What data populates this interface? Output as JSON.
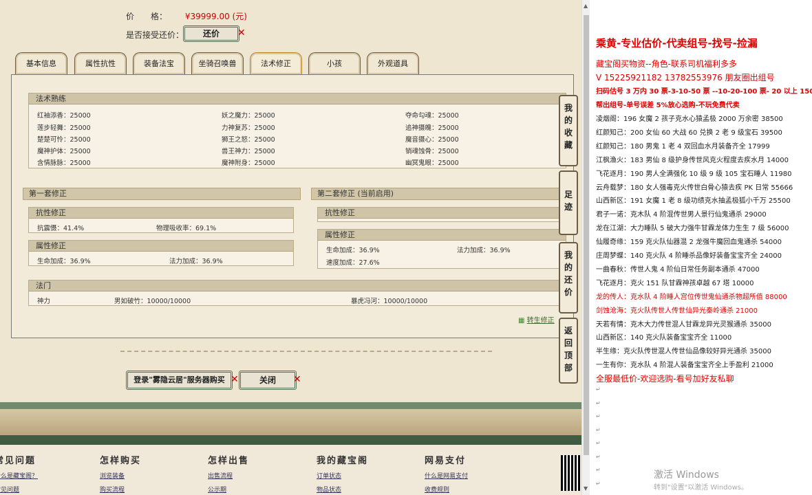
{
  "page": {
    "price_label": "价　　格：",
    "price_value": "¥39999.00 (元)",
    "bargain_label": "是否接受还价：",
    "bargain_button": "还价"
  },
  "tabs": [
    "基本信息",
    "属性抗性",
    "装备法宝",
    "坐骑召唤兽",
    "法术修正",
    "小孩",
    "外观道具"
  ],
  "spell_box": {
    "title": "法术熟练",
    "rows": [
      [
        "红袖添香：25000",
        "妖之魔力：25000",
        "夺命勾魂：25000"
      ],
      [
        "莲步轻舞：25000",
        "力神复苏：25000",
        "追神摄魄：25000"
      ],
      [
        "楚楚可怜：25000",
        "狮王之怒：25000",
        "魔音摄心：25000"
      ],
      [
        "魔神护体：25000",
        "兽王神力：25000",
        "销魂蚀骨：25000"
      ],
      [
        "含情脉脉：25000",
        "魔神附身：25000",
        "幽冥鬼眼：25000"
      ]
    ]
  },
  "set1": {
    "title": "第一套修正",
    "resist_title": "抗性修正",
    "resist": [
      "抗震慑：41.4%",
      "物理吸收率：69.1%"
    ],
    "attr_title": "属性修正",
    "attr": [
      "生命加成：36.9%",
      "法力加成：36.9%"
    ]
  },
  "set2": {
    "title": "第二套修正 (当前启用)",
    "resist_title": "抗性修正",
    "attr_title": "属性修正",
    "attr": [
      "生命加成：36.9%",
      "法力加成：36.9%",
      "速度加成：27.6%"
    ]
  },
  "famen": {
    "title": "法门",
    "label": "神力",
    "items": [
      "男如破竹：10000/10000",
      "暴虎冯河：10000/10000"
    ]
  },
  "transfer_link": "转生修正",
  "side_tabs": [
    "我的收藏",
    "足迹",
    "我的还价",
    "返回顶部"
  ],
  "buttons": {
    "login_buy": "登录\"雾隐云居\"服务器购买",
    "close": "关闭"
  },
  "footer": {
    "cols": [
      {
        "title": "常见问题",
        "links": [
          "什么是藏宝阁？",
          "常见问题"
        ]
      },
      {
        "title": "怎样购买",
        "links": [
          "浏览装备",
          "购买流程"
        ]
      },
      {
        "title": "怎样出售",
        "links": [
          "出售流程",
          "公示期"
        ]
      },
      {
        "title": "我的藏宝阁",
        "links": [
          "订单状态",
          "物品状态"
        ]
      },
      {
        "title": "网易支付",
        "links": [
          "什么是网易支付",
          "收费规则"
        ]
      }
    ]
  },
  "right_panel": {
    "title": "乘黄-专业估价-代卖组号-找号-捡漏",
    "lines": [
      {
        "text": "藏宝阁买物资--角色-联系司机福利多多",
        "color": "#e00000",
        "size": 12
      },
      {
        "text": "V 15225921182   13782553976 朋友圈出组号",
        "color": "#e00000",
        "size": 12
      },
      {
        "text": "扫码估号 3 万内 30 票-3-10-50 票 --10-20-100 票- 20 以上 150",
        "color": "#e00000",
        "size": 10,
        "bold": true
      },
      {
        "text": "帮出组号-单号误差 5%放心选购-不玩免费代卖",
        "color": "#e00000",
        "size": 10,
        "bold": true
      },
      {
        "text": "凌烟阁：196 女魔 2 孩子克水心猿孟极 2000 万余密 38500",
        "color": "#222",
        "size": 10
      },
      {
        "text": "红颜知己：200 女仙 60 大战 60 兑换 2 老 9 级宝石 39500",
        "color": "#222",
        "size": 10
      },
      {
        "text": "红颜知己：180 男鬼 1 老 4 双回血水月装备齐全 17999",
        "color": "#222",
        "size": 10
      },
      {
        "text": "江枫渔火：183 男仙 8 级护身传世风克火程度去疾水月 14000",
        "color": "#222",
        "size": 10
      },
      {
        "text": "飞花逐月：190 男人全满强化 10 级 9 级 105 宝石睡人 11980",
        "color": "#222",
        "size": 10
      },
      {
        "text": "云舟载梦：180 女人强毒克火传世白骨心猿去疾 PK 日常 55666",
        "color": "#222",
        "size": 10
      },
      {
        "text": "山西新区：191 女魔 1 老 8 级功绩克水抽孟极狐小千万 25500",
        "color": "#222",
        "size": 10
      },
      {
        "text": "君子一诺：克木队 4 阶混传世男人景行仙鬼通杀 29000",
        "color": "#222",
        "size": 10
      },
      {
        "text": "龙在江湖：大力睡队 5 破大力强牛甘霖龙体力生生 7 级 56000",
        "color": "#222",
        "size": 10
      },
      {
        "text": "仙履奇缘：159 克火队仙器混 2 龙强牛魔回血鬼通杀 54000",
        "color": "#222",
        "size": 10
      },
      {
        "text": "庄周梦蝶：140 克火队 4 阶睡杀品像好装备宝宝齐全 24000",
        "color": "#222",
        "size": 10
      },
      {
        "text": "一曲春秋：传世人鬼 4 阶仙日常任务副本通杀 47000",
        "color": "#222",
        "size": 10
      },
      {
        "text": "飞花逐月：克火 151 队甘霖神孩卓越 67 塔 10000",
        "color": "#222",
        "size": 10
      },
      {
        "text": "龙的传人：克水队 4 阶睡人宫位传世鬼仙通杀物超所值 88000",
        "color": "#e00000",
        "size": 10
      },
      {
        "text": "剑蚀沧海：克火队传世人传世仙异光秦岭通杀 21000",
        "color": "#e00000",
        "size": 10
      },
      {
        "text": "天若有情：克木大力传世混人甘霖龙异光灵猴通杀 35000",
        "color": "#222",
        "size": 10
      },
      {
        "text": "山西新区：140 克火队装备宝宝齐全 11000",
        "color": "#222",
        "size": 10
      },
      {
        "text": "半生缘：克火队传世混人传世仙品像较好异光通杀 35000",
        "color": "#222",
        "size": 10
      },
      {
        "text": "一生有你：克水队 4 阶混人装备宝宝齐全上手盈利 21000",
        "color": "#222",
        "size": 10
      },
      {
        "text": "全服最低价-欢迎选购-看号加好友私聊",
        "color": "#e00000",
        "size": 12
      }
    ],
    "windows_watermark": "激活 Windows",
    "windows_sub": "转到\"设置\"以激活 Windows。"
  }
}
